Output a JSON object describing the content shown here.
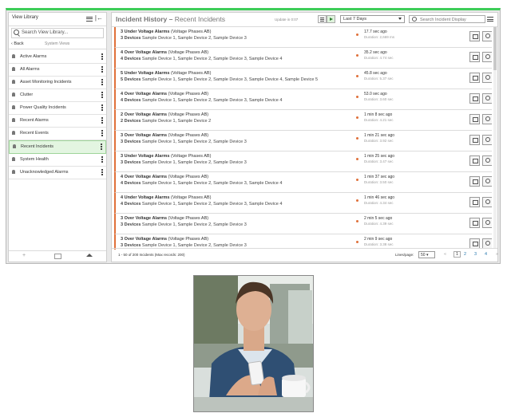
{
  "sidebar": {
    "title": "View Library",
    "search_placeholder": "Search View Library...",
    "back_label": "Back",
    "section_label": "System Views",
    "items": [
      {
        "label": "Active Alarms"
      },
      {
        "label": "All Alarms"
      },
      {
        "label": "Asset Monitoring Incidents"
      },
      {
        "label": "Clutter"
      },
      {
        "label": "Power Quality Incidents"
      },
      {
        "label": "Recent Alarms"
      },
      {
        "label": "Recent Events"
      },
      {
        "label": "Recent Incidents",
        "selected": true
      },
      {
        "label": "System Health"
      },
      {
        "label": "Unacknowledged Alarms"
      }
    ],
    "footer": {
      "add": "+",
      "add_folder": "folder-plus-icon",
      "home": "home-icon"
    }
  },
  "main": {
    "title": "Incident History",
    "subtitle": "Recent Incidents",
    "update_text": "Update in 0:07",
    "time_range": "Last 7 Days",
    "search_placeholder": "Search Incident Display",
    "rows": [
      {
        "count": "3",
        "type": "Under Voltage Alarms",
        "phase": "(Voltage Phases AB)",
        "devices_count": "3",
        "devices": "Sample Device 1, Sample Device 2, Sample Device 3",
        "ago": "17.7 sec ago",
        "duration": "Duration: 2,669 ms"
      },
      {
        "count": "4",
        "type": "Over Voltage Alarms",
        "phase": "(Voltage Phases AB)",
        "devices_count": "4",
        "devices": "Sample Device 1, Sample Device 2, Sample Device 3, Sample Device 4",
        "ago": "35.2 sec ago",
        "duration": "Duration: 4.74 sec"
      },
      {
        "count": "5",
        "type": "Under Voltage Alarms",
        "phase": "(Voltage Phases AB)",
        "devices_count": "5",
        "devices": "Sample Device 1, Sample Device 2, Sample Device 3, Sample Device 4, Sample Device 5",
        "ago": "45.8 sec ago",
        "duration": "Duration: 5.37 sec"
      },
      {
        "count": "4",
        "type": "Over Voltage Alarms",
        "phase": "(Voltage Phases AB)",
        "devices_count": "4",
        "devices": "Sample Device 1, Sample Device 2, Sample Device 3, Sample Device 4",
        "ago": "53.0 sec ago",
        "duration": "Duration: 3.60 sec"
      },
      {
        "count": "2",
        "type": "Over Voltage Alarms",
        "phase": "(Voltage Phases AB)",
        "devices_count": "2",
        "devices": "Sample Device 1, Sample Device 2",
        "ago": "1 min 8 sec ago",
        "duration": "Duration: 4.21 sec"
      },
      {
        "count": "3",
        "type": "Over Voltage Alarms",
        "phase": "(Voltage Phases AB)",
        "devices_count": "3",
        "devices": "Sample Device 1, Sample Device 2, Sample Device 3",
        "ago": "1 min 21 sec ago",
        "duration": "Duration: 3.92 sec"
      },
      {
        "count": "3",
        "type": "Under Voltage Alarms",
        "phase": "(Voltage Phases AB)",
        "devices_count": "3",
        "devices": "Sample Device 1, Sample Device 2, Sample Device 3",
        "ago": "1 min 25 sec ago",
        "duration": "Duration: 3.47 sec"
      },
      {
        "count": "4",
        "type": "Over Voltage Alarms",
        "phase": "(Voltage Phases AB)",
        "devices_count": "4",
        "devices": "Sample Device 1, Sample Device 2, Sample Device 3, Sample Device 4",
        "ago": "1 min 37 sec ago",
        "duration": "Duration: 3.50 sec"
      },
      {
        "count": "4",
        "type": "Under Voltage Alarms",
        "phase": "(Voltage Phases AB)",
        "devices_count": "4",
        "devices": "Sample Device 1, Sample Device 2, Sample Device 3, Sample Device 4",
        "ago": "1 min 46 sec ago",
        "duration": "Duration: 4.34 sec"
      },
      {
        "count": "3",
        "type": "Over Voltage Alarms",
        "phase": "(Voltage Phases AB)",
        "devices_count": "3",
        "devices": "Sample Device 1, Sample Device 2, Sample Device 3",
        "ago": "2 min 5 sec ago",
        "duration": "Duration: 4.39 sec"
      },
      {
        "count": "3",
        "type": "Over Voltage Alarms",
        "phase": "(Voltage Phases AB)",
        "devices_count": "3",
        "devices": "Sample Device 1, Sample Device 2, Sample Device 3",
        "ago": "2 min 9 sec ago",
        "duration": "Duration: 3.38 sec"
      }
    ],
    "footer": {
      "count_text": "1 - 50 of 200 Incidents (Max records: 200)",
      "lines_label": "Lines/page:",
      "lines_value": "50",
      "pages": [
        "1",
        "2",
        "3",
        "4"
      ],
      "prev": "«",
      "next": "»"
    }
  }
}
